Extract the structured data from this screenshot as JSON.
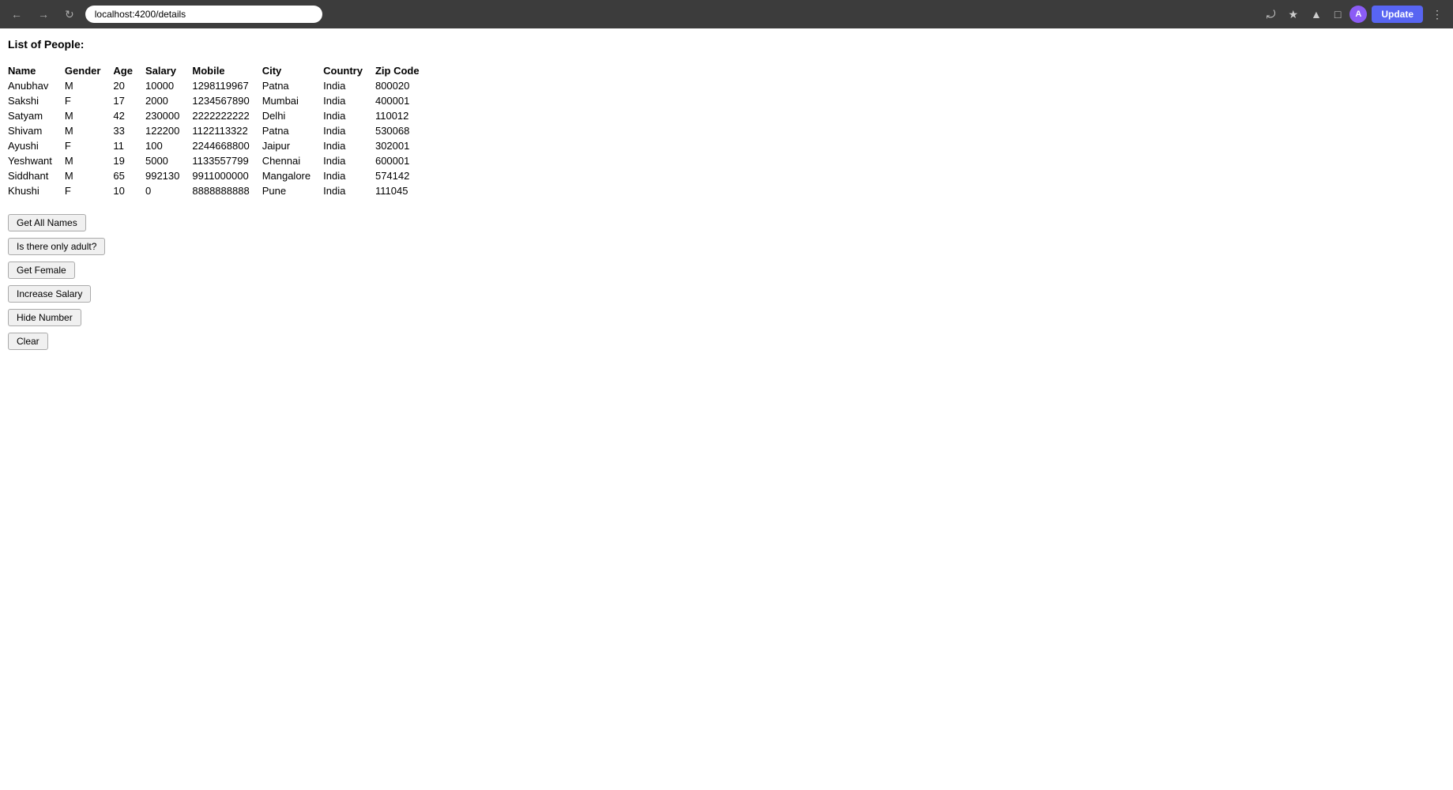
{
  "browser": {
    "url": "localhost:4200/details",
    "update_label": "Update",
    "avatar_label": "A"
  },
  "page": {
    "title": "List of People:"
  },
  "table": {
    "headers": [
      "Name",
      "Gender",
      "Age",
      "Salary",
      "Mobile",
      "City",
      "Country",
      "Zip Code"
    ],
    "rows": [
      [
        "Anubhav",
        "M",
        "20",
        "10000",
        "1298119967",
        "Patna",
        "India",
        "800020"
      ],
      [
        "Sakshi",
        "F",
        "17",
        "2000",
        "1234567890",
        "Mumbai",
        "India",
        "400001"
      ],
      [
        "Satyam",
        "M",
        "42",
        "230000",
        "2222222222",
        "Delhi",
        "India",
        "110012"
      ],
      [
        "Shivam",
        "M",
        "33",
        "122200",
        "1122113322",
        "Patna",
        "India",
        "530068"
      ],
      [
        "Ayushi",
        "F",
        "11",
        "100",
        "2244668800",
        "Jaipur",
        "India",
        "302001"
      ],
      [
        "Yeshwant",
        "M",
        "19",
        "5000",
        "1133557799",
        "Chennai",
        "India",
        "600001"
      ],
      [
        "Siddhant",
        "M",
        "65",
        "992130",
        "9911000000",
        "Mangalore",
        "India",
        "574142"
      ],
      [
        "Khushi",
        "F",
        "10",
        "0",
        "8888888888",
        "Pune",
        "India",
        "111045"
      ]
    ]
  },
  "buttons": {
    "get_all_names": "Get All Names",
    "is_adult": "Is there only adult?",
    "get_female": "Get Female",
    "increase_salary": "Increase Salary",
    "hide_number": "Hide Number",
    "clear": "Clear"
  }
}
